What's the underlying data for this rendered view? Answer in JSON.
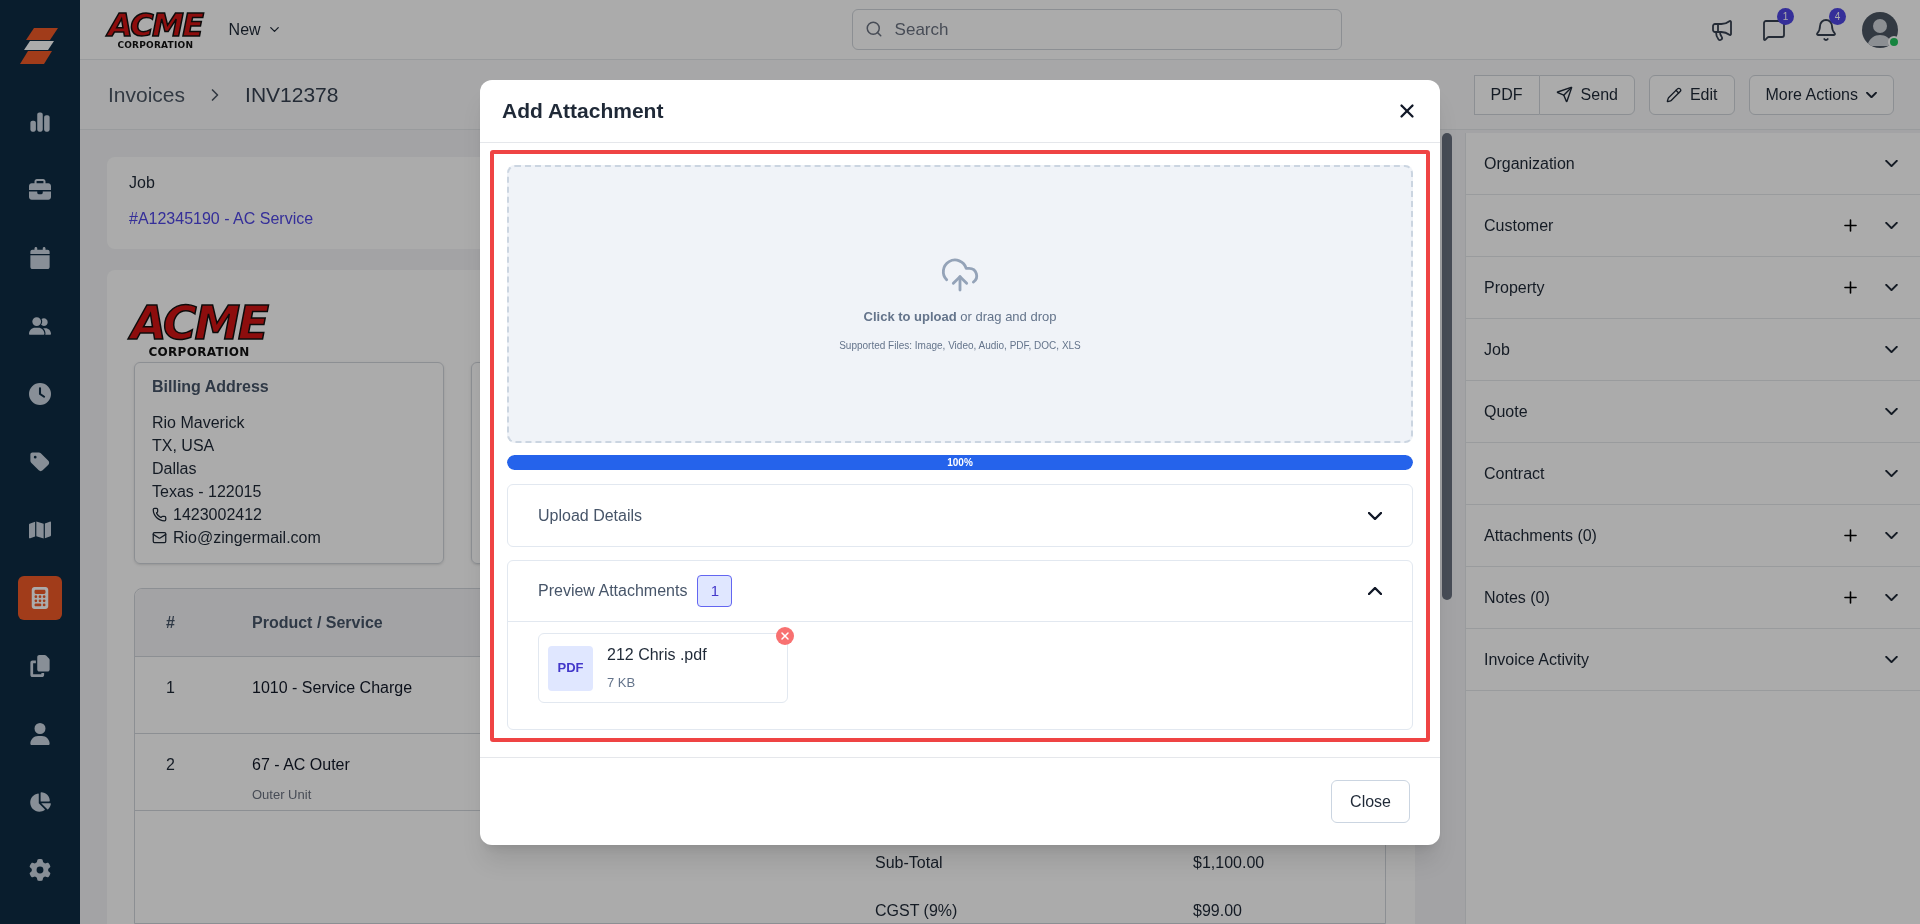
{
  "sidebar": {
    "items": [
      {
        "selected": false
      },
      {
        "selected": false
      },
      {
        "selected": false
      },
      {
        "selected": false
      },
      {
        "selected": false
      },
      {
        "selected": false
      },
      {
        "selected": false
      },
      {
        "selected": true
      },
      {
        "selected": false
      },
      {
        "selected": false
      },
      {
        "selected": false
      },
      {
        "selected": false
      }
    ]
  },
  "topbar": {
    "logo": {
      "word": "ACME",
      "sub": "CORPORATION"
    },
    "new_menu": "New",
    "search": {
      "placeholder": "Search"
    },
    "icons": [
      {
        "kind": "megaphone"
      },
      {
        "kind": "chat",
        "badge": "1"
      },
      {
        "kind": "bell",
        "badge": "4"
      },
      {
        "kind": "avatar",
        "online": true
      }
    ]
  },
  "breadcrumb": [
    "Invoices",
    "INV12378"
  ],
  "actions": [
    {
      "kind": "pdf",
      "label": "PDF"
    },
    {
      "kind": "send",
      "label": "Send"
    },
    {
      "kind": "edit",
      "label": "Edit"
    },
    {
      "kind": "more",
      "label": "More Actions"
    }
  ],
  "job": {
    "label": "Job",
    "link": "#A12345190 - AC Service"
  },
  "invoice": {
    "logo": {
      "word": "ACME",
      "sub": "CORPORATION"
    },
    "billing": {
      "title": "Billing Address",
      "lines": [
        {
          "kind": "text",
          "text": "Rio Maverick"
        },
        {
          "kind": "text",
          "text": "TX, USA"
        },
        {
          "kind": "text",
          "text": "Dallas"
        },
        {
          "kind": "text",
          "text": "Texas - 122015"
        },
        {
          "kind": "phone",
          "text": "1423002412"
        },
        {
          "kind": "email",
          "text": "Rio@zingermail.com"
        }
      ]
    },
    "table": {
      "columns": [
        "#",
        "Product / Service"
      ],
      "rows": [
        {
          "index": "1",
          "product": "1010 - Service Charge"
        },
        {
          "index": "2",
          "product": "67 - AC Outer",
          "description": "Outer Unit"
        }
      ],
      "totals": [
        {
          "label": "Sub-Total",
          "value": "$1,100.00"
        },
        {
          "label": "CGST (9%)",
          "value": "$99.00"
        }
      ]
    }
  },
  "right_panel": {
    "sections": [
      {
        "title": "Organization",
        "addable": false,
        "expanded": false
      },
      {
        "title": "Customer",
        "addable": true,
        "expanded": false
      },
      {
        "title": "Property",
        "addable": true,
        "expanded": false
      },
      {
        "title": "Job",
        "addable": false,
        "expanded": false
      },
      {
        "title": "Quote",
        "addable": false,
        "expanded": false
      },
      {
        "title": "Contract",
        "addable": false,
        "expanded": false
      },
      {
        "title": "Attachments (0)",
        "addable": true,
        "expanded": false
      },
      {
        "title": "Notes (0)",
        "addable": true,
        "expanded": false
      },
      {
        "title": "Invoice Activity",
        "addable": false,
        "expanded": false
      }
    ]
  },
  "modal": {
    "title": "Add Attachment",
    "highlighted": true,
    "dropzone": {
      "prompt": "**Click to upload** or drag and drop",
      "supported": "Supported Files: Image, Video, Audio, PDF, DOC, XLS"
    },
    "progress": {
      "level": 1,
      "label": "100%"
    },
    "sections": [
      {
        "title": "Upload Details",
        "expanded": false
      },
      {
        "title": "Preview Attachments",
        "count": "1",
        "expanded": true,
        "files": [
          {
            "type": "PDF",
            "name": "212 Chris .pdf",
            "size": "7 KB"
          }
        ]
      }
    ],
    "footer_button": "Close"
  }
}
